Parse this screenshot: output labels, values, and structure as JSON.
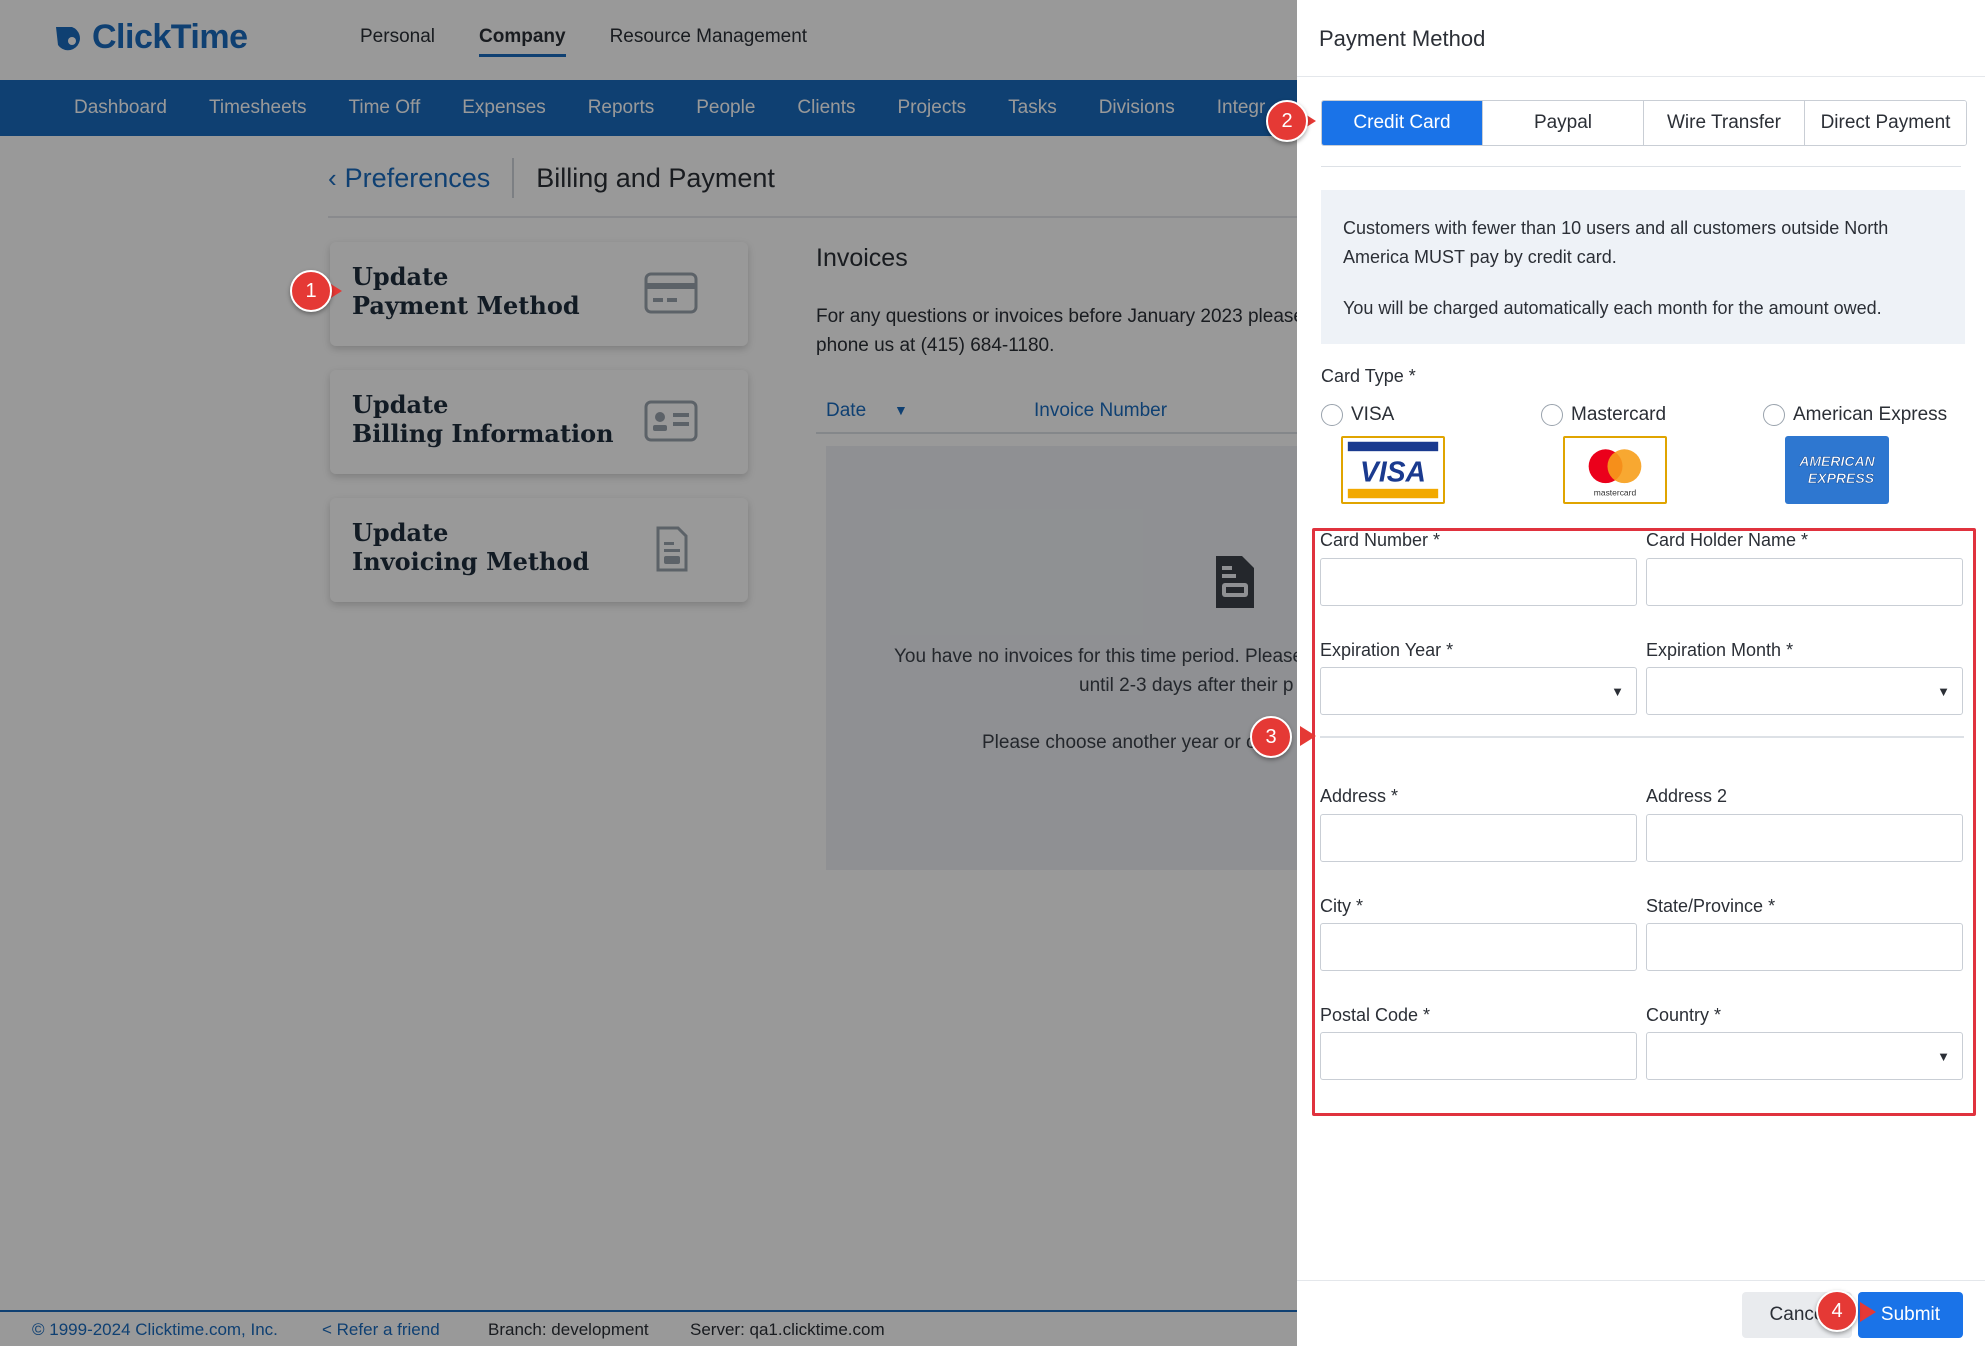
{
  "app": {
    "logo_text": "ClickTime",
    "top_nav": [
      "Personal",
      "Company",
      "Resource Management"
    ],
    "active_top_nav": "Company",
    "sub_nav": [
      "Dashboard",
      "Timesheets",
      "Time Off",
      "Expenses",
      "Reports",
      "People",
      "Clients",
      "Projects",
      "Tasks",
      "Divisions",
      "Integr"
    ]
  },
  "breadcrumb": {
    "back_label": "Preferences",
    "current": "Billing and Payment"
  },
  "cards": [
    {
      "line1": "Update",
      "line2": "Payment Method",
      "icon": "credit-card-icon"
    },
    {
      "line1": "Update",
      "line2": "Billing Information",
      "icon": "id-card-icon"
    },
    {
      "line1": "Update",
      "line2": "Invoicing Method",
      "icon": "document-icon"
    }
  ],
  "invoices": {
    "title": "Invoices",
    "info_line1": "For any questions or invoices before January 2023 please",
    "info_line2": "phone us at (415) 684-1180.",
    "col_date": "Date",
    "col_invoice_number": "Invoice Number",
    "empty_line1": "You have no invoices for this time period. Please",
    "empty_line2": "until 2-3 days after their p",
    "empty_line3": "Please choose another year or c"
  },
  "footer": {
    "copyright": "© 1999-2024 Clicktime.com, Inc.",
    "refer": "Refer a friend",
    "branch": "Branch: development",
    "server": "Server: qa1.clicktime.com"
  },
  "drawer": {
    "title": "Payment Method",
    "tabs": [
      "Credit Card",
      "Paypal",
      "Wire Transfer",
      "Direct Payment"
    ],
    "active_tab": "Credit Card",
    "notice_p1": "Customers with fewer than 10 users and all customers outside North America MUST pay by credit card.",
    "notice_p2": "You will be charged automatically each month for the amount owed.",
    "card_type_label": "Card Type *",
    "card_types": [
      "VISA",
      "Mastercard",
      "American Express"
    ],
    "card_logo_text": {
      "visa": "VISA",
      "mastercard": "mastercard",
      "amex_1": "AMERICAN",
      "amex_2": "EXPRESS"
    },
    "fields": {
      "card_number": "Card Number *",
      "card_holder": "Card Holder Name *",
      "exp_year": "Expiration Year *",
      "exp_month": "Expiration Month *",
      "address": "Address *",
      "address2": "Address 2",
      "city": "City *",
      "state": "State/Province *",
      "postal": "Postal Code *",
      "country": "Country *"
    },
    "cancel_label": "Cance",
    "submit_label": "Submit"
  },
  "callouts": [
    "1",
    "2",
    "3",
    "4"
  ],
  "colors": {
    "brand_blue": "#1a6bbf",
    "active_tab": "#1a73e8",
    "callout_red": "#e53935",
    "highlight_red": "#e0323e"
  }
}
